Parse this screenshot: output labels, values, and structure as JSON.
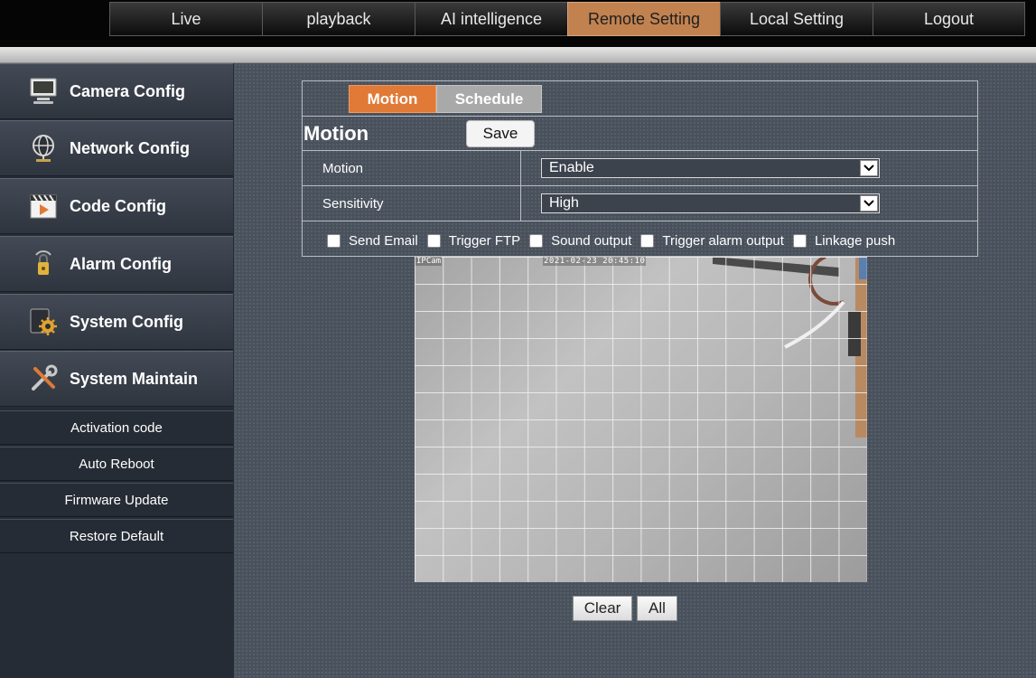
{
  "nav": {
    "tabs": [
      {
        "label": "Live"
      },
      {
        "label": "playback"
      },
      {
        "label": "AI intelligence"
      },
      {
        "label": "Remote Setting",
        "active": true
      },
      {
        "label": "Local Setting"
      },
      {
        "label": "Logout"
      }
    ]
  },
  "sidebar": {
    "items": [
      {
        "label": "Camera Config",
        "icon": "monitor-icon"
      },
      {
        "label": "Network Config",
        "icon": "globe-icon"
      },
      {
        "label": "Code Config",
        "icon": "video-clip-icon"
      },
      {
        "label": "Alarm Config",
        "icon": "alarm-lock-icon"
      },
      {
        "label": "System Config",
        "icon": "gear-icon"
      },
      {
        "label": "System Maintain",
        "icon": "tools-icon"
      }
    ],
    "subitems": [
      {
        "label": "Activation code"
      },
      {
        "label": "Auto Reboot"
      },
      {
        "label": "Firmware Update"
      },
      {
        "label": "Restore Default"
      }
    ]
  },
  "panel": {
    "tabs": {
      "motion": "Motion",
      "schedule": "Schedule"
    },
    "title": "Motion",
    "save_label": "Save",
    "rows": [
      {
        "label": "Motion",
        "value": "Enable"
      },
      {
        "label": "Sensitivity",
        "value": "High"
      }
    ],
    "checkboxes": [
      {
        "label": "Send Email",
        "checked": false
      },
      {
        "label": "Trigger FTP",
        "checked": false
      },
      {
        "label": "Sound output",
        "checked": false
      },
      {
        "label": "Trigger alarm output",
        "checked": false
      },
      {
        "label": "Linkage push",
        "checked": false
      }
    ]
  },
  "video": {
    "osd_name": "IPCam",
    "osd_time": "2021-02-23 20:45:10"
  },
  "buttons": {
    "clear": "Clear",
    "all": "All"
  },
  "colors": {
    "accent": "#e07a36",
    "active_nav": "#c18250",
    "tab_inactive": "#a9a9a9"
  }
}
